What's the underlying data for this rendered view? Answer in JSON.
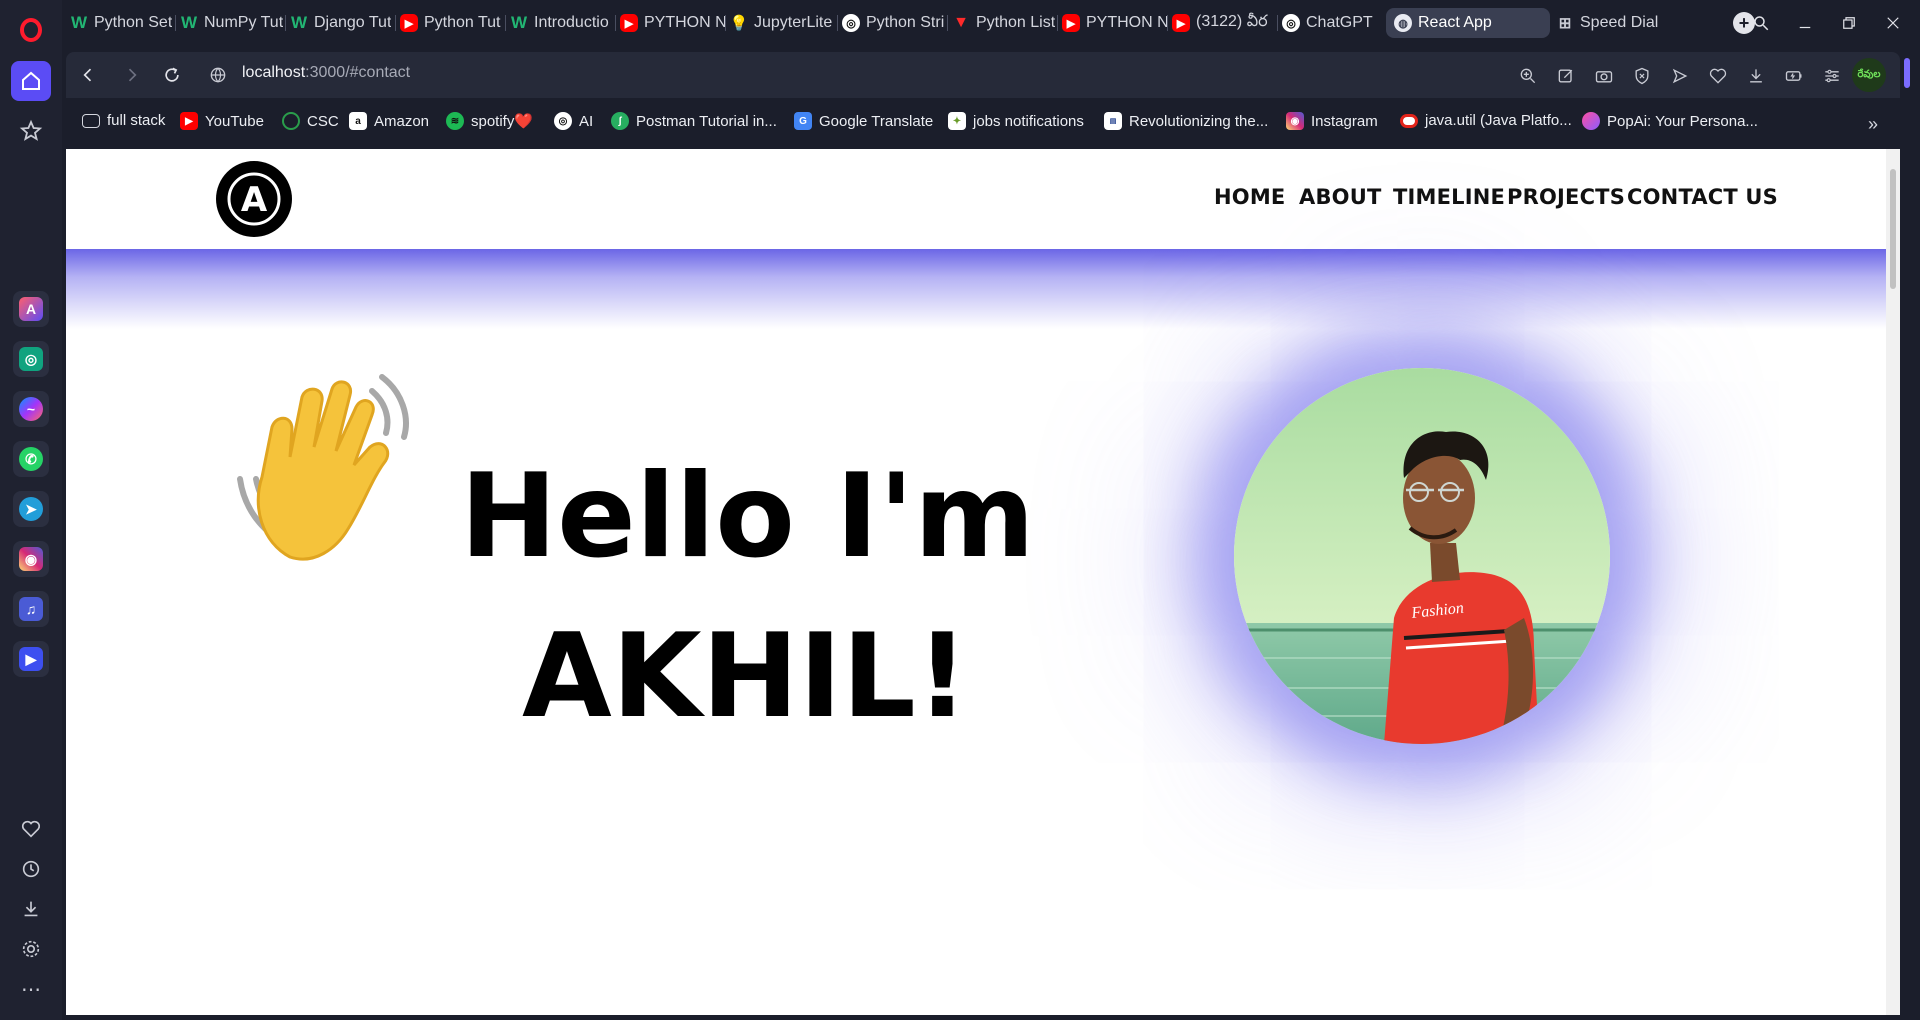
{
  "browser": {
    "tabs": [
      {
        "title": "Python Set",
        "icon": "w3schools-icon"
      },
      {
        "title": "NumPy Tut",
        "icon": "w3schools-icon"
      },
      {
        "title": "Django Tut",
        "icon": "w3schools-icon"
      },
      {
        "title": "Python Tut",
        "icon": "youtube-icon"
      },
      {
        "title": "Introductio",
        "icon": "w3schools-icon"
      },
      {
        "title": "PYTHON N",
        "icon": "youtube-icon"
      },
      {
        "title": "JupyterLite",
        "icon": "lightbulb-icon"
      },
      {
        "title": "Python Stri",
        "icon": "chatgpt-icon"
      },
      {
        "title": "Python List",
        "icon": "v-icon"
      },
      {
        "title": "PYTHON N",
        "icon": "youtube-icon"
      },
      {
        "title": "(3122) వీర",
        "icon": "youtube-icon"
      },
      {
        "title": "ChatGPT",
        "icon": "chatgpt-icon"
      },
      {
        "title": "React App",
        "icon": "globe-icon"
      },
      {
        "title": "Speed Dial",
        "icon": "grid-icon"
      }
    ],
    "url": {
      "host": "localhost",
      "rest": ":3000/#contact"
    },
    "bookmarks": [
      {
        "label": "full stack",
        "icon": "folder-icon"
      },
      {
        "label": "YouTube",
        "icon": "youtube-icon"
      },
      {
        "label": "CSC",
        "icon": "csc-icon"
      },
      {
        "label": "Amazon",
        "icon": "amazon-icon"
      },
      {
        "label": "spotify❤️",
        "icon": "spotify-icon"
      },
      {
        "label": "AI",
        "icon": "chatgpt-icon"
      },
      {
        "label": "Postman Tutorial in...",
        "icon": "postman-icon"
      },
      {
        "label": "Google Translate",
        "icon": "translate-icon"
      },
      {
        "label": "jobs notifications",
        "icon": "jobs-icon"
      },
      {
        "label": "Revolutionizing the...",
        "icon": "news-icon"
      },
      {
        "label": "Instagram",
        "icon": "instagram-icon"
      },
      {
        "label": "java.util (Java Platfo...",
        "icon": "oracle-icon"
      },
      {
        "label": "PopAi: Your Persona...",
        "icon": "popai-icon"
      }
    ],
    "profile_badge": "రేవుల"
  },
  "site": {
    "logo_letter": "A",
    "nav": [
      "HOME",
      "ABOUT",
      "TIMELINE",
      "PROJECTS",
      "CONTACT US"
    ],
    "hero": {
      "line1": "Hello I'm",
      "line2": "AKHIL!"
    }
  },
  "colors": {
    "accent": "#6b66e6",
    "browser_bg": "#1b1e2b"
  }
}
